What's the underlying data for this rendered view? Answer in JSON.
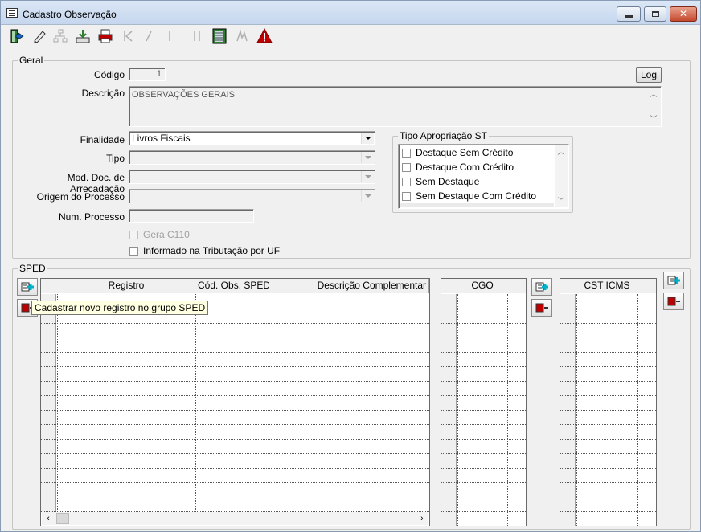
{
  "window": {
    "title": "Cadastro Observação"
  },
  "toolbar": {
    "icons": [
      "exit-icon",
      "edit-icon",
      "tree-icon",
      "save-down-icon",
      "print-icon",
      "first-icon",
      "prev-icon",
      "next-icon",
      "last-icon",
      "table-icon",
      "calc-icon",
      "warning-icon"
    ]
  },
  "geral": {
    "legend": "Geral",
    "codigo_label": "Código",
    "codigo_value": "1",
    "log_label": "Log",
    "descricao_label": "Descrição",
    "descricao_value": "OBSERVAÇÕES GERAIS",
    "finalidade_label": "Finalidade",
    "finalidade_value": "Livros Fiscais",
    "tipo_label": "Tipo",
    "mod_doc_label": "Mod. Doc. de Arrecadação",
    "origem_label": "Origem do Processo",
    "num_processo_label": "Num. Processo",
    "gera_c110_label": "Gera C110",
    "informado_label": "Informado na Tributação por UF"
  },
  "tipo_apropriacao": {
    "legend": "Tipo Apropriação ST",
    "items": [
      "Destaque Sem Crédito",
      "Destaque Com Crédito",
      "Sem Destaque",
      "Sem Destaque Com Crédito"
    ]
  },
  "sped": {
    "legend": "SPED",
    "columns": [
      "Registro",
      "Cód. Obs. SPED",
      "Descrição Complementar"
    ],
    "cgo_header": "CGO",
    "cst_header": "CST ICMS",
    "tooltip": "Cadastrar novo registro no grupo SPED"
  },
  "colors": {
    "accent_red": "#c00000",
    "accent_cyan": "#00b0c8",
    "titlebar": "#c5d6ee"
  }
}
